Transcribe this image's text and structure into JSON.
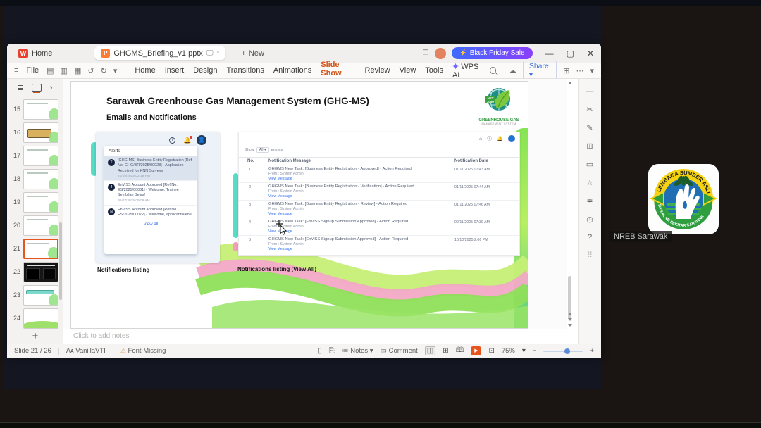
{
  "icons": {
    "plus": "+",
    "minimize": "—",
    "maximize": "▢",
    "close": "✕",
    "ellipsis": "⋯",
    "chevron_down": "▾",
    "chevron_right": "›",
    "hamburger": "≡",
    "undo": "↺",
    "redo": "↻",
    "bolt": "⚡",
    "cloud": "☁",
    "panel": "⊞",
    "bell": "🔔",
    "warn": "⚠",
    "play": "▶",
    "minus": "−",
    "info": "i",
    "overlap": "❐",
    "doc_screen": "🖵",
    "modified": "*",
    "w_logo": "W",
    "p_logo": "P",
    "search_note": "⌕"
  },
  "titlebar": {
    "home_tab": "Home",
    "doc_tab": "GHGMS_Briefing_v1.pptx",
    "new_label": "New",
    "sale_label": "Black Friday Sale"
  },
  "menubar": {
    "file": "File",
    "quick_icons": [
      "▤",
      "▥",
      "▦",
      "↺",
      "↻"
    ],
    "items": [
      "Home",
      "Insert",
      "Design",
      "Transitions",
      "Animations",
      "Slide Show",
      "Review",
      "View",
      "Tools"
    ],
    "active_item": "Slide Show",
    "wps_ai": "WPS AI",
    "share": "Share"
  },
  "thumbnails": [
    "15",
    "16",
    "17",
    "18",
    "19",
    "20",
    "21",
    "22",
    "23",
    "24"
  ],
  "slide": {
    "title": "Sarawak Greenhouse Gas Management System (GHG-MS)",
    "subtitle": "Emails and Notifications",
    "logo": {
      "badge": "NET 2050",
      "line1": "GREENHOUSE GAS",
      "line2": "MANAGEMENT SYSTEM"
    },
    "captions": {
      "left": "Notifications listing",
      "right": "Notifications listing (View All)"
    },
    "alerts_panel": {
      "header": "Alerts",
      "items": [
        {
          "avatar": "T",
          "text": "[GHG-MS] Business Entity Registration [Ref No. GHG/BR/2025/00028] - Application Received for KNN Surveys",
          "date": "21/10/2025 02:19 PM"
        },
        {
          "avatar": "J",
          "text": "EnViSS Account Approved [Ref No. ES/2025/00081] - Welcome, Trainee Sembilan Belas!",
          "date": "30/07/2025 09:09 AM"
        },
        {
          "avatar": "N",
          "text": "EnViSS Account Approved [Ref No. ES/2025/00072] - Welcome, applicantName!",
          "date": ""
        }
      ],
      "view_all": "View all"
    },
    "listing": {
      "show_label": "Show",
      "show_value": "All",
      "entries_label": "entries",
      "columns": {
        "no": "No.",
        "message": "Notification Message",
        "date": "Notification Date"
      },
      "rows": [
        {
          "no": "1",
          "message": "GHGMS New Task: [Business Entity Registration - Approved] - Action Required",
          "from": "From : System Admin",
          "link": "View Message",
          "date": "01/11/2025 07:43 AM"
        },
        {
          "no": "2",
          "message": "GHGMS New Task: [Business Entity Registration - Verification] - Action Required",
          "from": "From : System Admin",
          "link": "View Message",
          "date": "01/11/2025 07:44 AM"
        },
        {
          "no": "3",
          "message": "GHGMS New Task: [Business Entity Registration - Review] - Action Required",
          "from": "From : System Admin",
          "link": "View Message",
          "date": "01/11/2025 07:46 AM"
        },
        {
          "no": "4",
          "message": "GHGMS New Task: [EnViSS Signup Submission Approved] - Action Required",
          "from": "From : System Admin",
          "link": "View Message",
          "date": "02/11/2025 07:39 AM"
        },
        {
          "no": "5",
          "message": "GHGMS New Task: [EnViSS Signup Submission Approved] - Action Required",
          "from": "From : System Admin",
          "link": "View Message",
          "date": "16/10/2025 2:06 PM"
        }
      ]
    }
  },
  "notes": {
    "placeholder": "Click to add notes"
  },
  "side_toolbar": [
    "—",
    "✂",
    "✎",
    "⊞",
    "▭",
    "☆",
    "≑",
    "◷",
    "?",
    "⠿"
  ],
  "statusbar": {
    "slide_count": "Slide 21 / 26",
    "theme": "VanillaVTI",
    "font_missing": "Font Missing",
    "notes_label": "Notes",
    "comment_label": "Comment",
    "zoom": "75%"
  },
  "meeting": {
    "participant_name": "NREB Sarawak",
    "logo_top_text": "LEMBAGA SUMBER ASLI",
    "logo_bottom_text": "DAN ALAM SEKITAR SARAWAK"
  },
  "colors": {
    "accent": "#e8541d",
    "sale_from": "#3f6bff",
    "sale_to": "#8a3ffc",
    "link": "#2f6fed",
    "teal": "#57dcc5"
  }
}
